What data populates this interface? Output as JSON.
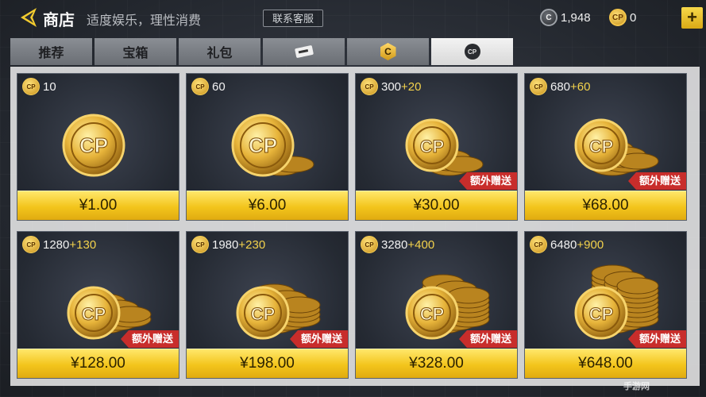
{
  "header": {
    "title": "商店",
    "tagline": "适度娱乐，理性消费",
    "customer_service": "联系客服",
    "currencies": [
      {
        "icon": "c-coin-icon",
        "value": "1,948"
      },
      {
        "icon": "cp-coin-icon",
        "value": "0"
      }
    ],
    "plus_label": "+"
  },
  "tabs": [
    {
      "label": "推荐",
      "icon": null,
      "active": false
    },
    {
      "label": "宝箱",
      "icon": null,
      "active": false
    },
    {
      "label": "礼包",
      "icon": null,
      "active": false
    },
    {
      "label": "",
      "icon": "ticket-icon",
      "active": false
    },
    {
      "label": "",
      "icon": "c-hex-icon",
      "active": false
    },
    {
      "label": "",
      "icon": "cp-icon",
      "active": true
    }
  ],
  "products": [
    {
      "amount": "10",
      "bonus": "",
      "price": "¥1.00",
      "extra": ""
    },
    {
      "amount": "60",
      "bonus": "",
      "price": "¥6.00",
      "extra": ""
    },
    {
      "amount": "300",
      "bonus": "+20",
      "price": "¥30.00",
      "extra": "额外赠送"
    },
    {
      "amount": "680",
      "bonus": "+60",
      "price": "¥68.00",
      "extra": "额外赠送"
    },
    {
      "amount": "1280",
      "bonus": "+130",
      "price": "¥128.00",
      "extra": "额外赠送"
    },
    {
      "amount": "1980",
      "bonus": "+230",
      "price": "¥198.00",
      "extra": "额外赠送"
    },
    {
      "amount": "3280",
      "bonus": "+400",
      "price": "¥328.00",
      "extra": "额外赠送"
    },
    {
      "amount": "6480",
      "bonus": "+900",
      "price": "¥648.00",
      "extra": "额外赠送"
    }
  ],
  "watermark": "手游网",
  "colors": {
    "accent": "#f3c51c",
    "badge_red": "#c82d2b"
  }
}
